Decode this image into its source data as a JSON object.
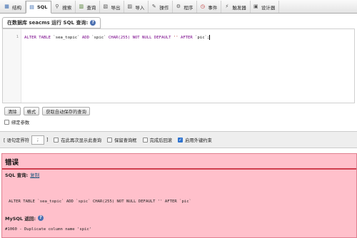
{
  "tabs": [
    {
      "label": "结构",
      "icon": "structure-icon",
      "color": "#3a6bb0"
    },
    {
      "label": "SQL",
      "icon": "sql-icon",
      "color": "#3a6bb0"
    },
    {
      "label": "搜索",
      "icon": "search-icon",
      "color": "#555555"
    },
    {
      "label": "查询",
      "icon": "query-icon",
      "color": "#4a7a2a"
    },
    {
      "label": "导出",
      "icon": "export-icon",
      "color": "#555555"
    },
    {
      "label": "导入",
      "icon": "import-icon",
      "color": "#555555"
    },
    {
      "label": "操作",
      "icon": "wrench-icon",
      "color": "#555555"
    },
    {
      "label": "程序",
      "icon": "routines-icon",
      "color": "#555555"
    },
    {
      "label": "事件",
      "icon": "clock-icon",
      "color": "#c03030"
    },
    {
      "label": "触发器",
      "icon": "trigger-icon",
      "color": "#555555"
    },
    {
      "label": "设计器",
      "icon": "designer-icon",
      "color": "#555555"
    }
  ],
  "query_title": "在数据库 seacms 运行 SQL 查询:",
  "editor": {
    "line_number": "1",
    "parts": [
      {
        "t": "ALTER TABLE ",
        "c": "kw"
      },
      {
        "t": "`sea_topic`",
        "c": "plain"
      },
      {
        "t": " ADD ",
        "c": "kw"
      },
      {
        "t": "`spic`",
        "c": "plain"
      },
      {
        "t": " CHAR(255) NOT NULL DEFAULT ",
        "c": "kw"
      },
      {
        "t": "''",
        "c": "str"
      },
      {
        "t": " AFTER ",
        "c": "kw"
      },
      {
        "t": "`pic`",
        "c": "plain"
      },
      {
        "t": ";",
        "c": "plain"
      }
    ]
  },
  "buttons": {
    "clear": "清除",
    "format": "格式",
    "get_saved": "获取自动保存的查询"
  },
  "bind_params": "绑定参数",
  "options": {
    "delimiter_label": "[ 语句定界符",
    "delimiter_value": ";",
    "delimiter_close": "]",
    "show_again": "在此再次显示此查询",
    "keep_box": "保留查询框",
    "rollback": "完成后回滚",
    "foreign_keys": "启用外键约束",
    "foreign_keys_checked": true
  },
  "error": {
    "title": "错误",
    "sql_query_label": "SQL 查询:",
    "copy_link": "复制",
    "sql_text": "ALTER TABLE `sea_topic` ADD `spic` CHAR(255) NOT NULL DEFAULT '' AFTER `pic`",
    "mysql_label": "MySQL 返回:",
    "message": "#1060 - Duplicate column name 'spic'"
  }
}
